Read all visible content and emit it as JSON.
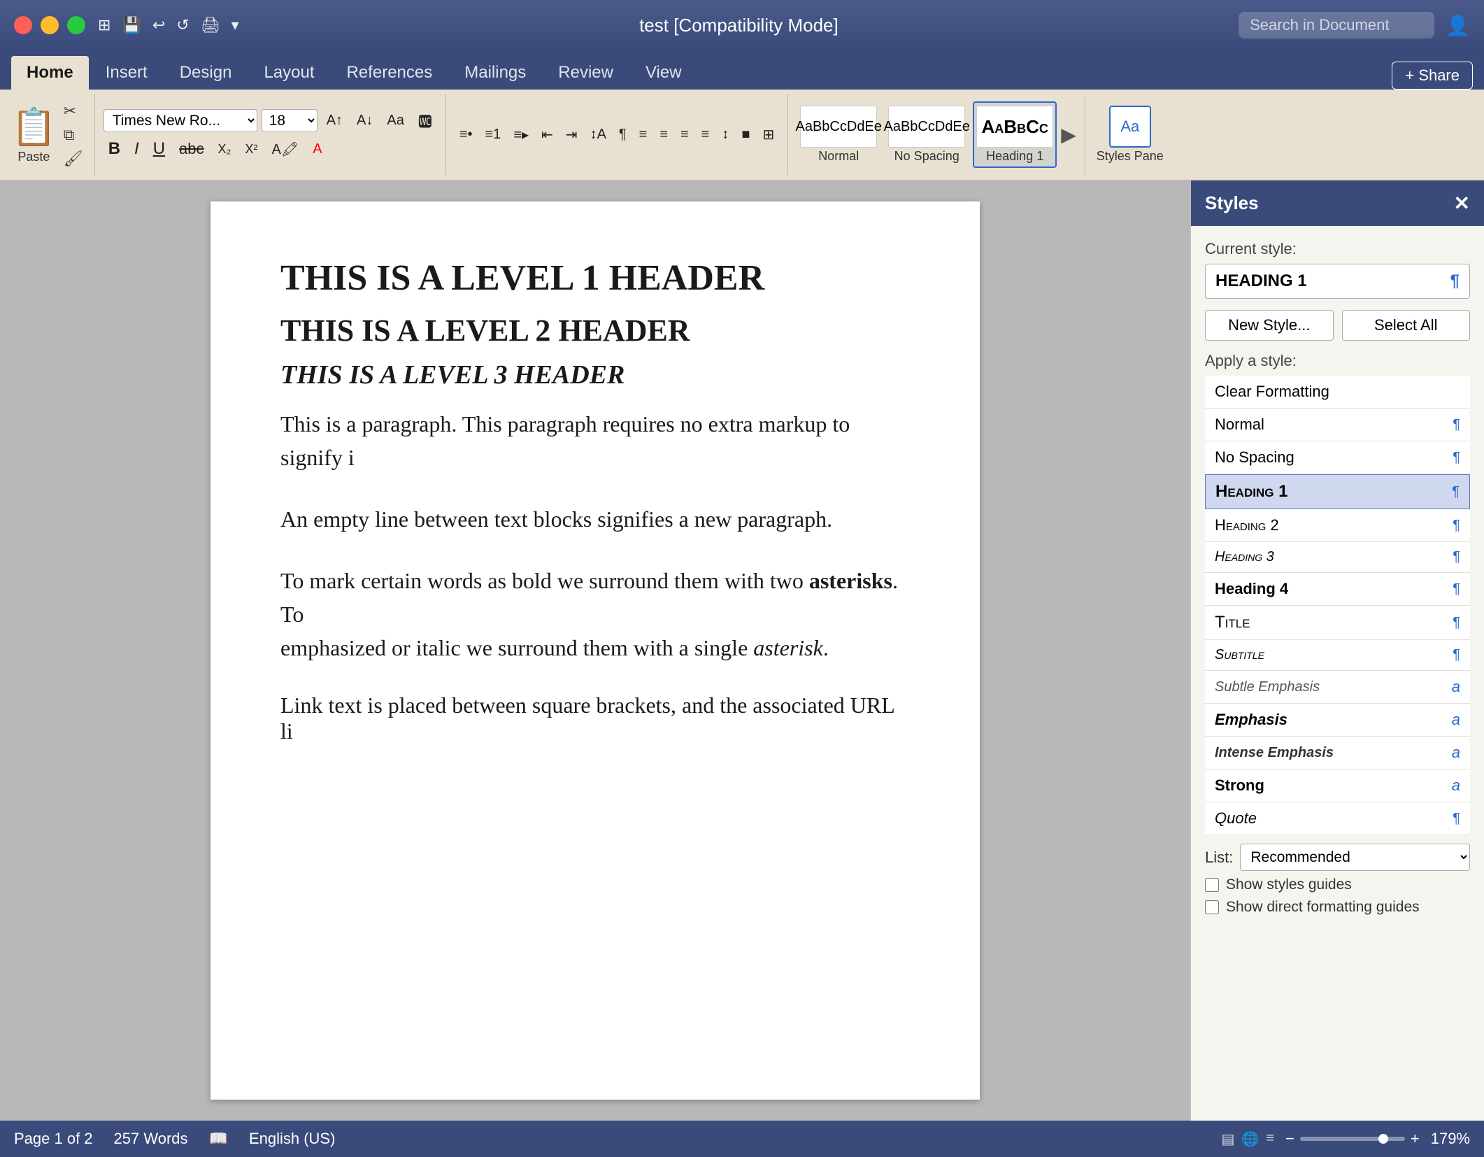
{
  "titlebar": {
    "title": "test [Compatibility Mode]",
    "search_placeholder": "Search in Document"
  },
  "tabs": {
    "items": [
      {
        "label": "Home",
        "active": true
      },
      {
        "label": "Insert",
        "active": false
      },
      {
        "label": "Design",
        "active": false
      },
      {
        "label": "Layout",
        "active": false
      },
      {
        "label": "References",
        "active": false
      },
      {
        "label": "Mailings",
        "active": false
      },
      {
        "label": "Review",
        "active": false
      },
      {
        "label": "View",
        "active": false
      }
    ],
    "share_label": "+ Share"
  },
  "ribbon": {
    "paste_label": "Paste",
    "font_name": "Times New Ro...",
    "font_size": "18",
    "bold": "B",
    "italic": "I",
    "underline": "U",
    "strikethrough": "abc",
    "subscript": "X₂",
    "superscript": "X²",
    "style_normal_label": "Normal",
    "style_nospacing_label": "No Spacing",
    "style_heading1_label": "Heading 1",
    "styles_pane_label": "Styles Pane"
  },
  "document": {
    "h1": "THIS IS A LEVEL 1 HEADER",
    "h2": "THIS IS A LEVEL 2 HEADER",
    "h3": "THIS IS A LEVEL 3 HEADER",
    "p1": "This is a paragraph. This paragraph requires no extra markup to signify i",
    "p2": "An empty line between text blocks signifies a new paragraph.",
    "p3_start": "To mark certain words as bold we surround them with two ",
    "p3_bold": "asterisks",
    "p3_middle": ". To",
    "p3_cont": "emphasized or italic we surround them with a single ",
    "p3_italic": "asterisk",
    "p3_end": ".",
    "p4_start": "Link text is placed between square brackets, and the associated URL li"
  },
  "styles_pane": {
    "title": "Styles",
    "current_style_label": "Current style:",
    "current_style_value": "HEADING 1",
    "new_style_label": "New Style...",
    "select_all_label": "Select All",
    "apply_style_label": "Apply a style:",
    "list_label": "List:",
    "list_value": "Recommended",
    "show_styles_guides": "Show styles guides",
    "show_direct_formatting": "Show direct formatting guides",
    "styles": [
      {
        "label": "Clear Formatting",
        "type": "clear",
        "selected": false
      },
      {
        "label": "Normal",
        "type": "normal",
        "marker": "¶",
        "selected": false
      },
      {
        "label": "No Spacing",
        "type": "nospacing",
        "marker": "¶",
        "selected": false
      },
      {
        "label": "Heading 1",
        "type": "heading1",
        "marker": "¶",
        "selected": true
      },
      {
        "label": "Heading 2",
        "type": "heading2",
        "marker": "¶",
        "selected": false
      },
      {
        "label": "Heading 3",
        "type": "heading3",
        "marker": "¶",
        "selected": false
      },
      {
        "label": "Heading 4",
        "type": "heading4",
        "marker": "¶",
        "selected": false
      },
      {
        "label": "Title",
        "type": "title",
        "marker": "¶",
        "selected": false
      },
      {
        "label": "Subtitle",
        "type": "subtitle",
        "marker": "¶",
        "selected": false
      },
      {
        "label": "Subtle Emphasis",
        "type": "subtle-em",
        "marker": "a",
        "selected": false
      },
      {
        "label": "Emphasis",
        "type": "emphasis",
        "marker": "a",
        "selected": false
      },
      {
        "label": "Intense Emphasis",
        "type": "intense-em",
        "marker": "a",
        "selected": false
      },
      {
        "label": "Strong",
        "type": "strong",
        "marker": "a",
        "selected": false
      },
      {
        "label": "Quote",
        "type": "quote",
        "marker": "¶",
        "selected": false
      }
    ]
  },
  "statusbar": {
    "page_info": "Page 1 of 2",
    "word_count": "257 Words",
    "language": "English (US)",
    "zoom_level": "179%"
  }
}
